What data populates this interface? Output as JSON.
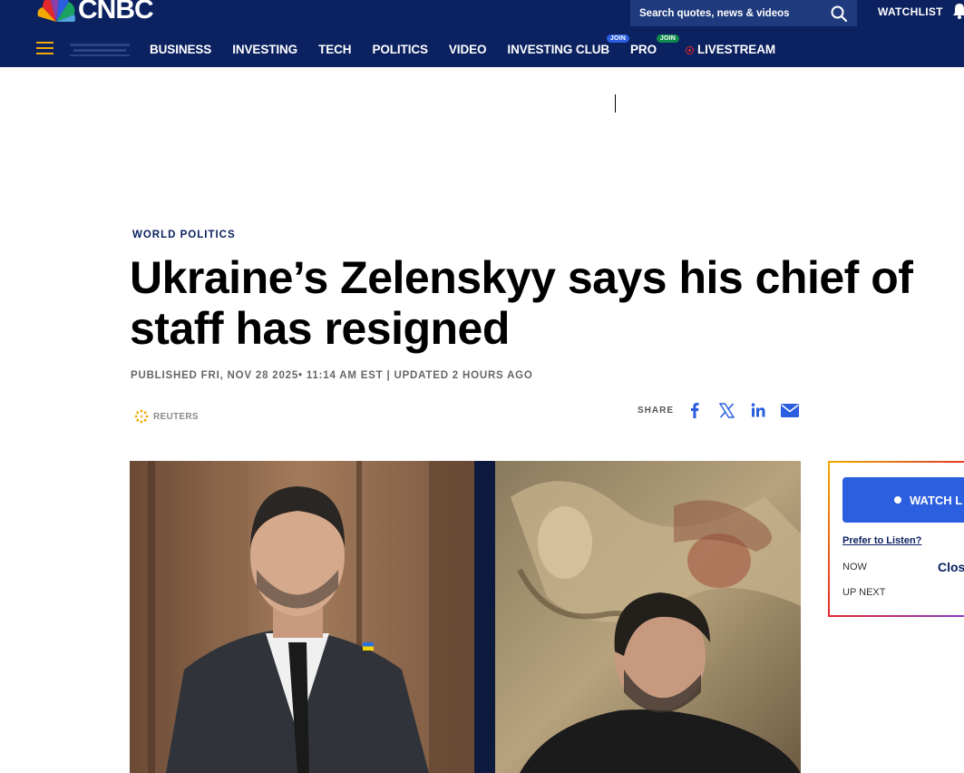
{
  "header": {
    "logo_text": "CNBC",
    "search_placeholder": "Search quotes, news & videos",
    "watchlist_label": "WATCHLIST",
    "nav": [
      {
        "label": "BUSINESS"
      },
      {
        "label": "INVESTING"
      },
      {
        "label": "TECH"
      },
      {
        "label": "POLITICS"
      },
      {
        "label": "VIDEO"
      },
      {
        "label": "INVESTING CLUB",
        "badge": "JOIN"
      },
      {
        "label": "PRO",
        "badge": "JOIN"
      },
      {
        "label": "LIVESTREAM"
      }
    ],
    "accent_color": "#0b2160"
  },
  "article": {
    "kicker": "WORLD POLITICS",
    "headline_line1": "Ukraine’s Zelenskyy says his chief of",
    "headline_line2": "staff has resigned",
    "timestamp": "PUBLISHED FRI, NOV 28 2025• 11:14 AM EST | UPDATED 2 HOURS AGO",
    "source": "REUTERS",
    "share_label": "SHARE",
    "share_icons": [
      "facebook-icon",
      "x-icon",
      "linkedin-icon",
      "email-icon"
    ]
  },
  "live": {
    "watch_label": "WATCH L",
    "listen_link": "Prefer to Listen?",
    "now_label": "NOW",
    "now_title": "Clos",
    "up_next_label": "UP NEXT"
  }
}
